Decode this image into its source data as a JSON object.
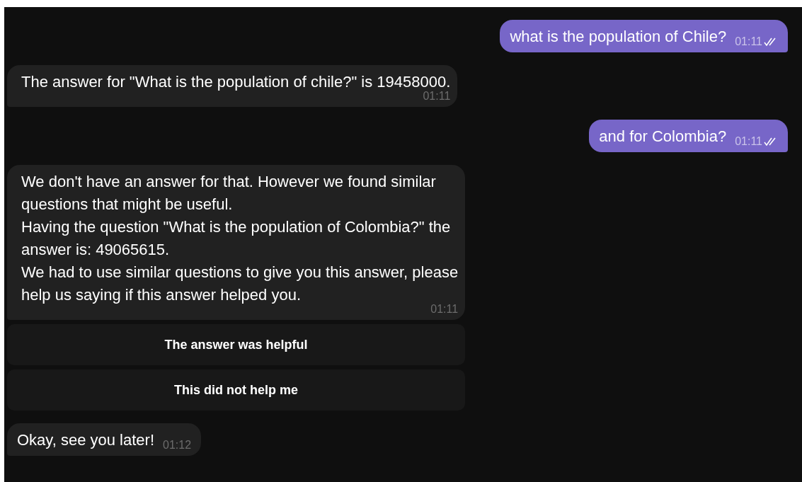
{
  "messages": [
    {
      "kind": "outgoing",
      "lines": [
        "what is the population of Chile?"
      ],
      "time": "01:11",
      "read": true
    },
    {
      "kind": "incoming",
      "lines": [
        "The answer for \"What is the population of chile?\" is 19458000."
      ],
      "time": "01:11",
      "tall": true
    },
    {
      "kind": "outgoing",
      "lines": [
        "and for Colombia?"
      ],
      "time": "01:11",
      "read": true
    },
    {
      "kind": "incoming",
      "lines": [
        "We don't have an answer for that. However we found similar",
        "questions that might be useful.",
        "Having the question \"What is the population of Colombia?\" the",
        "answer is: 49065615.",
        "We had to use similar questions to give you this answer, please",
        "help us saying if this answer helped you."
      ],
      "time": "01:11",
      "tall": true,
      "buttons": [
        "The answer was helpful",
        "This did not help me"
      ]
    },
    {
      "kind": "incoming",
      "lines": [
        "Okay, see you later!"
      ],
      "time": "01:12",
      "tall": false
    }
  ]
}
